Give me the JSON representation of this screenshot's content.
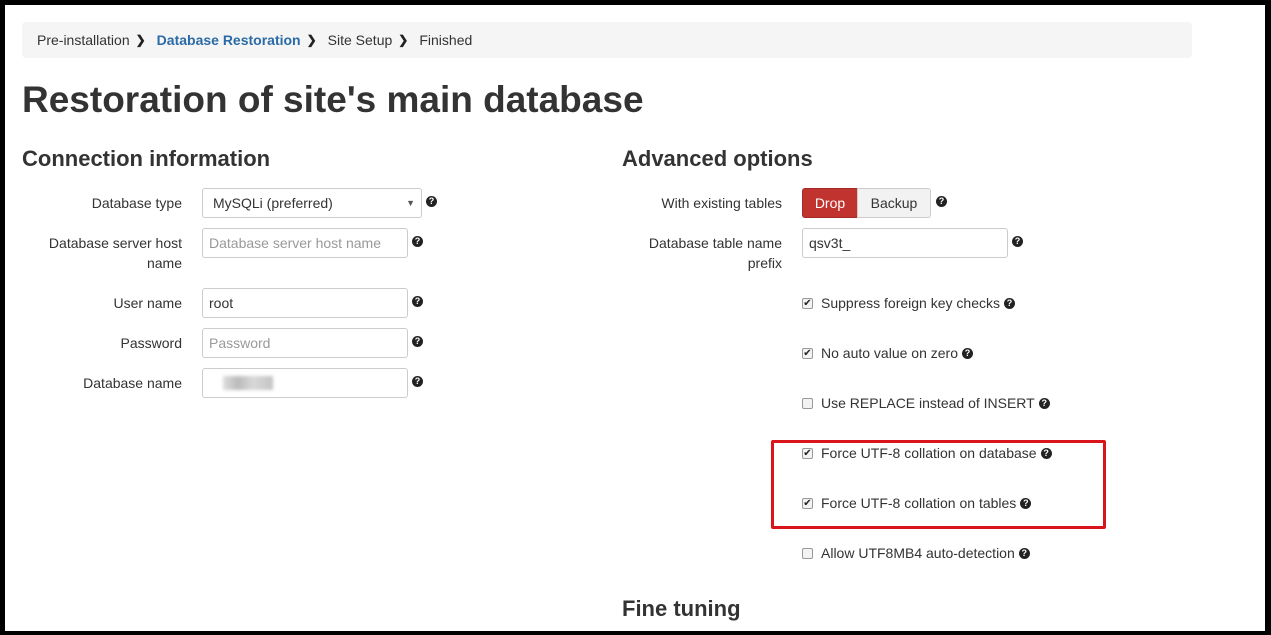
{
  "breadcrumb": {
    "items": [
      {
        "label": "Pre-installation",
        "active": false
      },
      {
        "label": "Database Restoration",
        "active": true
      },
      {
        "label": "Site Setup",
        "active": false
      },
      {
        "label": "Finished",
        "active": false
      }
    ],
    "separator": "❯"
  },
  "page_title": "Restoration of site's main database",
  "connection": {
    "heading": "Connection information",
    "db_type_label": "Database type",
    "db_type_value": "MySQLi (preferred)",
    "db_host_label_line1": "Database server host",
    "db_host_label_line2": "name",
    "db_host_placeholder": "Database server host name",
    "user_label": "User name",
    "user_value": "root",
    "password_label": "Password",
    "password_placeholder": "Password",
    "dbname_label": "Database name"
  },
  "advanced": {
    "heading": "Advanced options",
    "existing_tables_label": "With existing tables",
    "drop_label": "Drop",
    "backup_label": "Backup",
    "prefix_label_line1": "Database table name",
    "prefix_label_line2": "prefix",
    "prefix_value": "qsv3t_",
    "options": [
      {
        "label": "Suppress foreign key checks",
        "checked": true
      },
      {
        "label": "No auto value on zero",
        "checked": true
      },
      {
        "label": "Use REPLACE instead of INSERT",
        "checked": false
      },
      {
        "label": "Force UTF-8 collation on database",
        "checked": true
      },
      {
        "label": "Force UTF-8 collation on tables",
        "checked": true
      },
      {
        "label": "Allow UTF8MB4 auto-detection",
        "checked": false
      }
    ]
  },
  "fine_tuning": {
    "heading": "Fine tuning"
  },
  "help_glyph": "?",
  "select_arrow": "▼",
  "check_glyph": "✔",
  "colors": {
    "accent": "#2a6aa6",
    "danger": "#c0332e",
    "highlight": "#d9141b"
  }
}
